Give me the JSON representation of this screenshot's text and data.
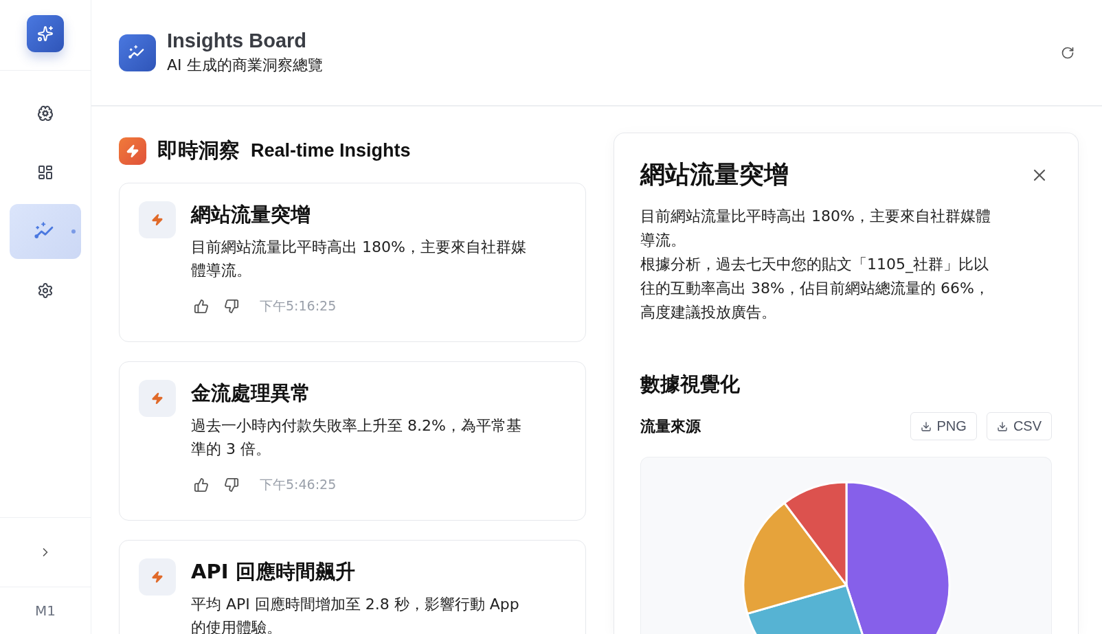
{
  "sidebar": {
    "items": [
      {
        "kind": "brain",
        "selected": false
      },
      {
        "kind": "grid",
        "selected": false
      },
      {
        "kind": "chart",
        "selected": true
      },
      {
        "kind": "gear",
        "selected": false
      }
    ],
    "user": "M1"
  },
  "header": {
    "title": "Insights Board",
    "subtitle": "AI 生成的商業洞察總覽"
  },
  "section": {
    "title": "即時洞察",
    "subtitle": "Real-time Insights"
  },
  "insights": [
    {
      "title": "網站流量突增",
      "body": "目前網站流量比平時高出 180%，主要來自社群媒體導流。",
      "time": "下午5:16:25"
    },
    {
      "title": "金流處理異常",
      "body": "過去一小時內付款失敗率上升至 8.2%，為平常基準的 3 倍。",
      "time": "下午5:46:25"
    },
    {
      "title": "API 回應時間飆升",
      "body": "平均 API 回應時間增加至 2.8 秒，影響行動 App 的使用體驗。"
    }
  ],
  "detail": {
    "title": "網站流量突增",
    "paragraphs": [
      "目前網站流量比平時高出 180%，主要來自社群媒體導流。",
      "根據分析，過去七天中您的貼文「1105_社群」比以往的互動率高出 38%，佔目前網站總流量的 66%，高度建議投放廣告。"
    ],
    "viz_title": "數據視覺化",
    "chart_title": "流量來源",
    "buttons": [
      "PNG",
      "CSV"
    ]
  }
}
